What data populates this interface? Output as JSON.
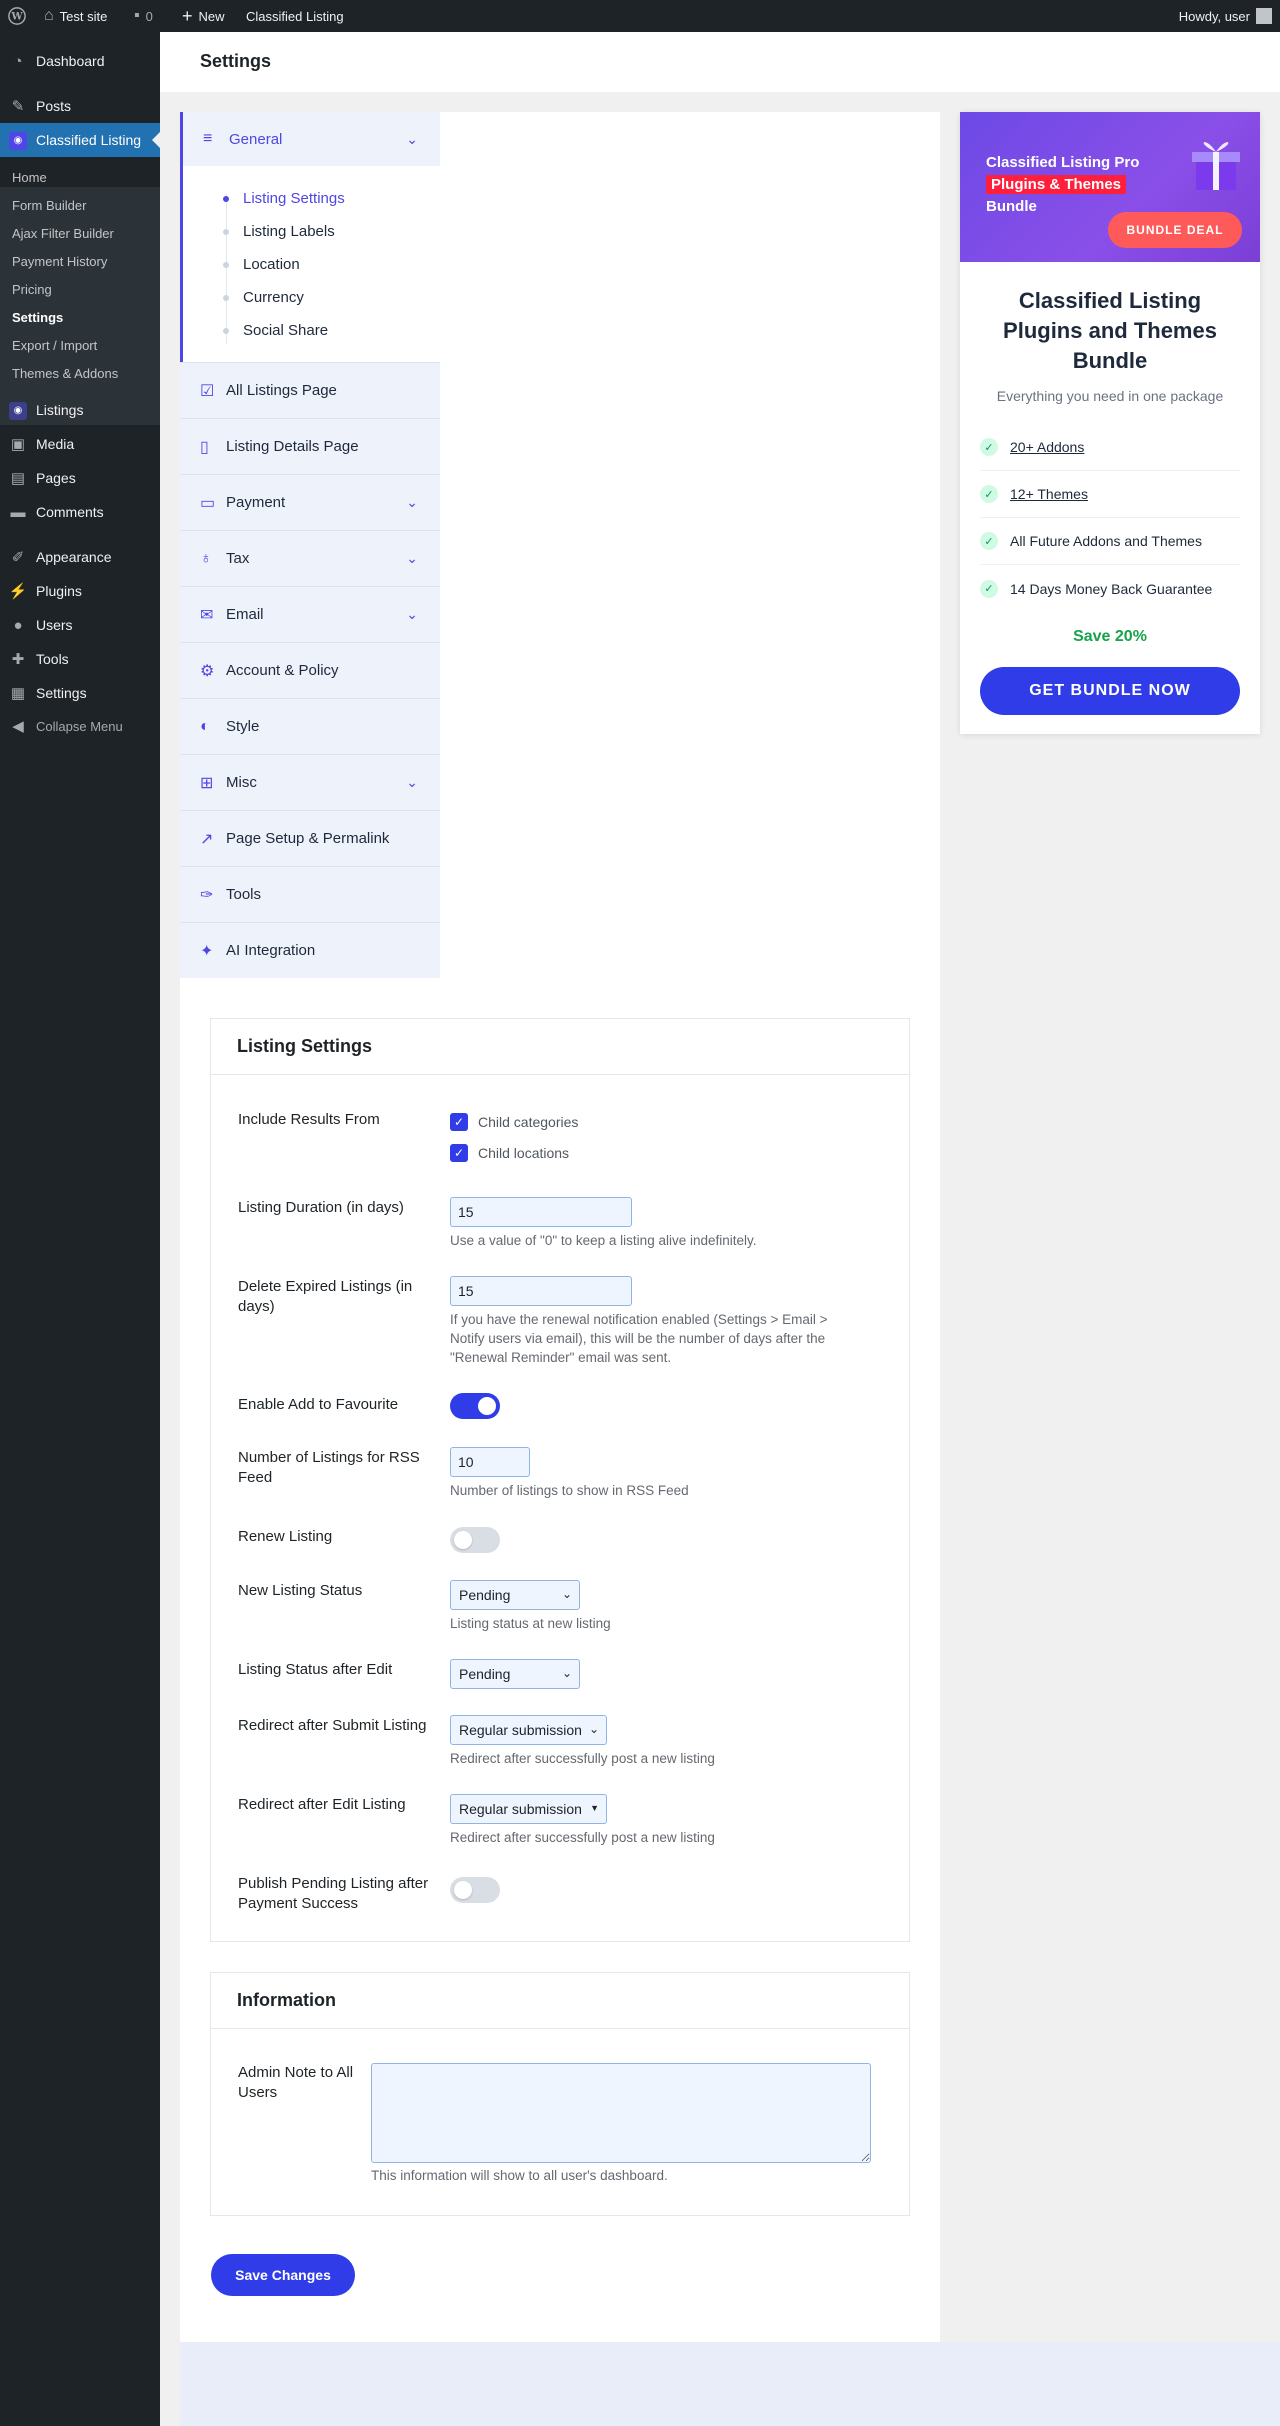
{
  "adminbar": {
    "site": "Test site",
    "comments": "0",
    "new": "New",
    "plugin": "Classified Listing",
    "howdy": "Howdy, user"
  },
  "menu": {
    "dashboard": "Dashboard",
    "posts": "Posts",
    "classified": "Classified Listing",
    "sub": [
      "Home",
      "Form Builder",
      "Ajax Filter Builder",
      "Payment History",
      "Pricing",
      "Settings",
      "Export / Import",
      "Themes & Addons"
    ],
    "listings": "Listings",
    "media": "Media",
    "pages": "Pages",
    "comments": "Comments",
    "appearance": "Appearance",
    "plugins": "Plugins",
    "users": "Users",
    "tools": "Tools",
    "settings": "Settings",
    "collapse": "Collapse Menu"
  },
  "page_title": "Settings",
  "settings_nav": {
    "general": "General",
    "general_sub": [
      "Listing Settings",
      "Listing Labels",
      "Location",
      "Currency",
      "Social Share"
    ],
    "items": [
      "All Listings Page",
      "Listing Details Page",
      "Payment",
      "Tax",
      "Email",
      "Account & Policy",
      "Style",
      "Misc",
      "Page Setup & Permalink",
      "Tools",
      "AI Integration"
    ]
  },
  "listing_settings": {
    "title": "Listing Settings",
    "include_label": "Include Results From",
    "child_categories": "Child categories",
    "child_locations": "Child locations",
    "duration_label": "Listing Duration (in days)",
    "duration_value": "15",
    "duration_desc": "Use a value of \"0\" to keep a listing alive indefinitely.",
    "delete_label": "Delete Expired Listings (in days)",
    "delete_value": "15",
    "delete_desc": "If you have the renewal notification enabled (Settings > Email > Notify users via email), this will be the number of days after the \"Renewal Reminder\" email was sent.",
    "favourite_label": "Enable Add to Favourite",
    "favourite_on": true,
    "rss_label": "Number of Listings for RSS Feed",
    "rss_value": "10",
    "rss_desc": "Number of listings to show in RSS Feed",
    "renew_label": "Renew Listing",
    "renew_on": false,
    "new_status_label": "New Listing Status",
    "new_status_value": "Pending",
    "new_status_desc": "Listing status at new listing",
    "edit_status_label": "Listing Status after Edit",
    "edit_status_value": "Pending",
    "redirect_submit_label": "Redirect after Submit Listing",
    "redirect_submit_value": "Regular submission",
    "redirect_submit_desc": "Redirect after successfully post a new listing",
    "redirect_edit_label": "Redirect after Edit Listing",
    "redirect_edit_value": "Regular submission",
    "redirect_edit_desc": "Redirect after successfully post a new listing",
    "publish_pending_label": "Publish Pending Listing after Payment Success",
    "publish_pending_on": false
  },
  "information": {
    "title": "Information",
    "admin_note_label": "Admin Note to All Users",
    "admin_note_value": "",
    "admin_note_desc": "This information will show to all user's dashboard."
  },
  "save_label": "Save Changes",
  "promo": {
    "banner_line1": "Classified Listing Pro",
    "banner_line2": "Plugins & Themes",
    "banner_line3": "Bundle",
    "deal_label": "BUNDLE DEAL",
    "title": "Classified Listing Plugins and Themes Bundle",
    "subtitle": "Everything you need in one package",
    "features": [
      "20+ Addons",
      "12+ Themes",
      "All Future Addons and Themes",
      "14 Days Money Back Guarantee"
    ],
    "save_text": "Save 20%",
    "button": "GET BUNDLE NOW"
  }
}
